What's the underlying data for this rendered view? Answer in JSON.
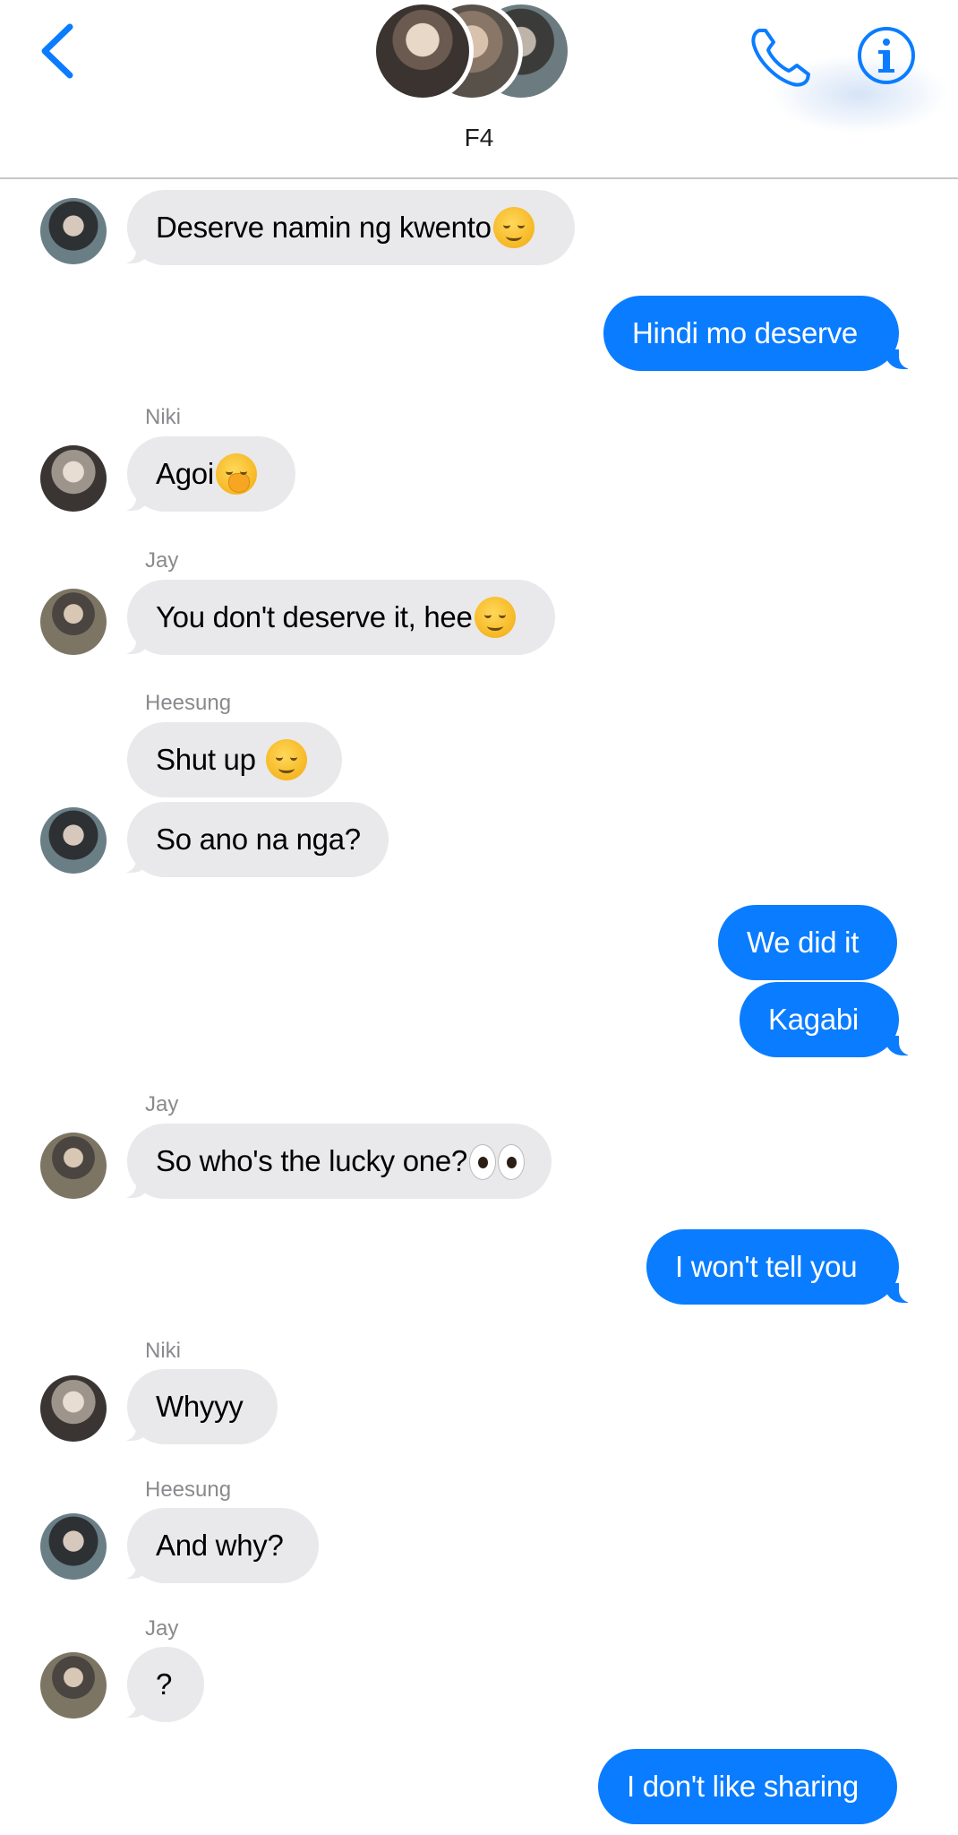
{
  "header": {
    "group_name": "F4",
    "back_icon": "chevron-left-icon",
    "call_icon": "phone-icon",
    "info_icon": "info-icon",
    "accent_color": "#0a7cff"
  },
  "colors": {
    "incoming_bubble": "#e9e9eb",
    "outgoing_bubble": "#0a7cff",
    "sender_label": "#8a8a8e"
  },
  "messages": [
    {
      "direction": "in",
      "sender": "Heesung",
      "text": "Deserve namin ng kwento",
      "emoji": "relieved-face"
    },
    {
      "direction": "out",
      "text": "Hindi mo deserve"
    },
    {
      "direction": "in",
      "sender": "Niki",
      "text": "Agoi",
      "emoji": "hand-over-mouth-face"
    },
    {
      "direction": "in",
      "sender": "Jay",
      "text": "You don't deserve it, hee",
      "emoji": "smiling-face"
    },
    {
      "direction": "in",
      "sender": "Heesung",
      "text": "Shut up ",
      "emoji": "slightly-smiling-face"
    },
    {
      "direction": "in",
      "sender": "Heesung",
      "text": "So ano na nga?"
    },
    {
      "direction": "out",
      "text": "We did it"
    },
    {
      "direction": "out",
      "text": "Kagabi"
    },
    {
      "direction": "in",
      "sender": "Jay",
      "text": "So who's the lucky one?",
      "emoji": "eyes"
    },
    {
      "direction": "out",
      "text": "I won't tell you"
    },
    {
      "direction": "in",
      "sender": "Niki",
      "text": "Whyyy"
    },
    {
      "direction": "in",
      "sender": "Heesung",
      "text": "And why?"
    },
    {
      "direction": "in",
      "sender": "Jay",
      "text": "?"
    },
    {
      "direction": "out",
      "text": "I don't like sharing"
    }
  ]
}
